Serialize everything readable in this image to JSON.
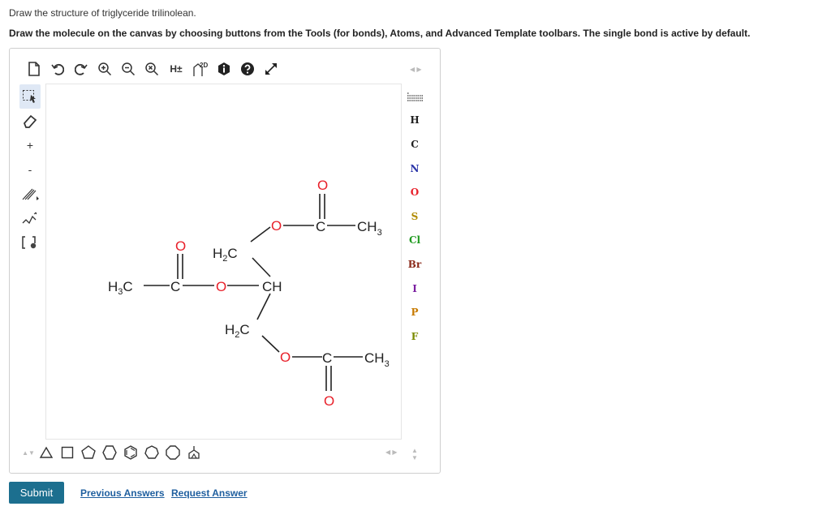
{
  "question": "Draw the structure of triglyceride trilinolean.",
  "instructions": "Draw the molecule on the canvas by choosing buttons from the Tools (for bonds), Atoms, and Advanced Template toolbars. The single bond is active by default.",
  "toolbar": {
    "hpm_label": "H±",
    "twod_label": "2D"
  },
  "left_toolbar": {
    "charge_plus": "+",
    "charge_minus": "-"
  },
  "atoms": [
    {
      "label": "H",
      "color": "#222222"
    },
    {
      "label": "C",
      "color": "#222222"
    },
    {
      "label": "N",
      "color": "#2b35a8"
    },
    {
      "label": "O",
      "color": "#e8202a"
    },
    {
      "label": "S",
      "color": "#b08a00"
    },
    {
      "label": "Cl",
      "color": "#1f9a1f"
    },
    {
      "label": "Br",
      "color": "#8b2a1a"
    },
    {
      "label": "I",
      "color": "#7a1fa0"
    },
    {
      "label": "P",
      "color": "#c77a00"
    },
    {
      "label": "F",
      "color": "#7a8a00"
    }
  ],
  "molecule": {
    "h3c_left": "H",
    "h3c_left_sub": "3",
    "h3c_left_c": "C",
    "c_left": "C",
    "o_left_dbl": "O",
    "o_left": "O",
    "ch_center": "CH",
    "h2c_top": "H",
    "h2c_top_sub": "2",
    "h2c_top_c": "C",
    "h2c_bot": "H",
    "h2c_bot_sub": "2",
    "h2c_bot_c": "C",
    "o_top": "O",
    "c_top": "C",
    "o_top_dbl": "O",
    "ch3_top": "CH",
    "ch3_top_sub": "3",
    "o_bot": "O",
    "c_bot": "C",
    "o_bot_dbl": "O",
    "ch3_bot": "CH",
    "ch3_bot_sub": "3"
  },
  "actions": {
    "submit": "Submit",
    "previous_answers": "Previous Answers",
    "request_answer": "Request Answer"
  }
}
